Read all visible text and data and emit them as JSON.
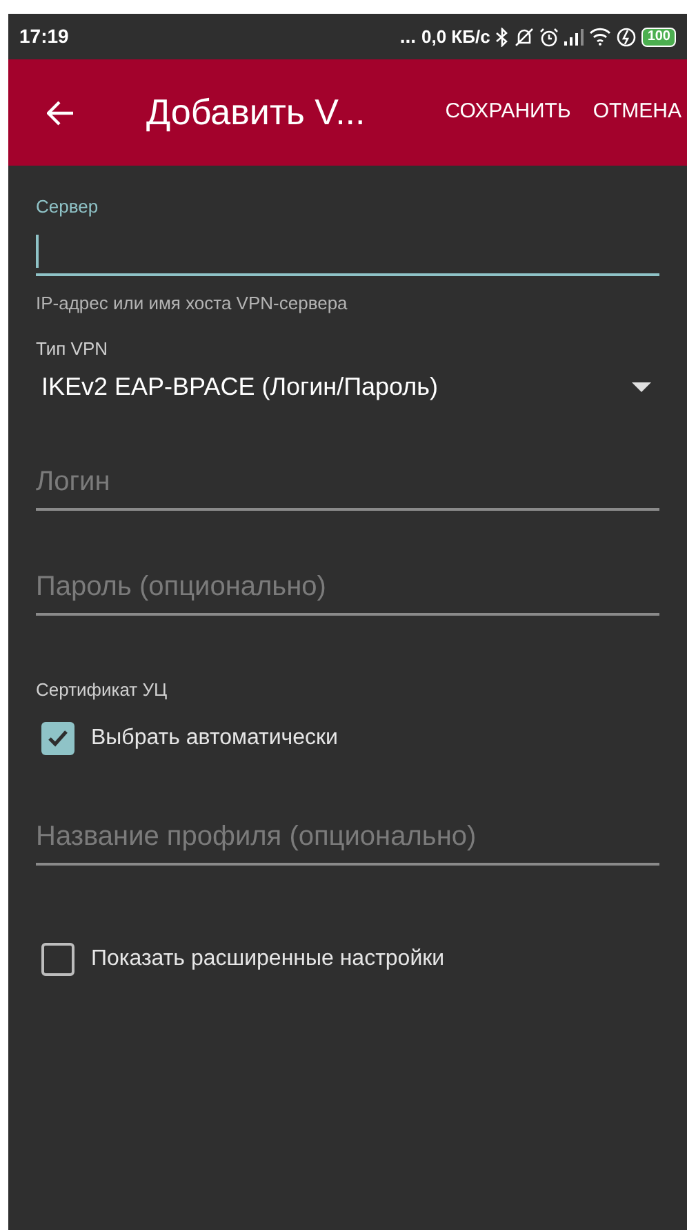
{
  "status_bar": {
    "time": "17:19",
    "more": "...",
    "speed": "0,0 КБ/с",
    "battery": "100"
  },
  "app_bar": {
    "title": "Добавить V...",
    "actions": [
      "СОХРАНИТЬ",
      "ОТМЕНА"
    ]
  },
  "server": {
    "label": "Сервер",
    "focused": true,
    "hint": "IP-адрес или имя хоста VPN-сервера"
  },
  "vpn_type": {
    "label": "Тип VPN",
    "value": "IKEv2 EAP-BPACE (Логин/Пароль)"
  },
  "login": {
    "placeholder": "Логин"
  },
  "password": {
    "placeholder": "Пароль (опционально)"
  },
  "certificate": {
    "label": "Сертификат УЦ",
    "option": {
      "label": "Выбрать автоматически",
      "checked": true
    }
  },
  "profile_name": {
    "placeholder": "Название профиля (опционально)"
  },
  "advanced": {
    "label": "Показать расширенные настройки",
    "checked": false
  }
}
